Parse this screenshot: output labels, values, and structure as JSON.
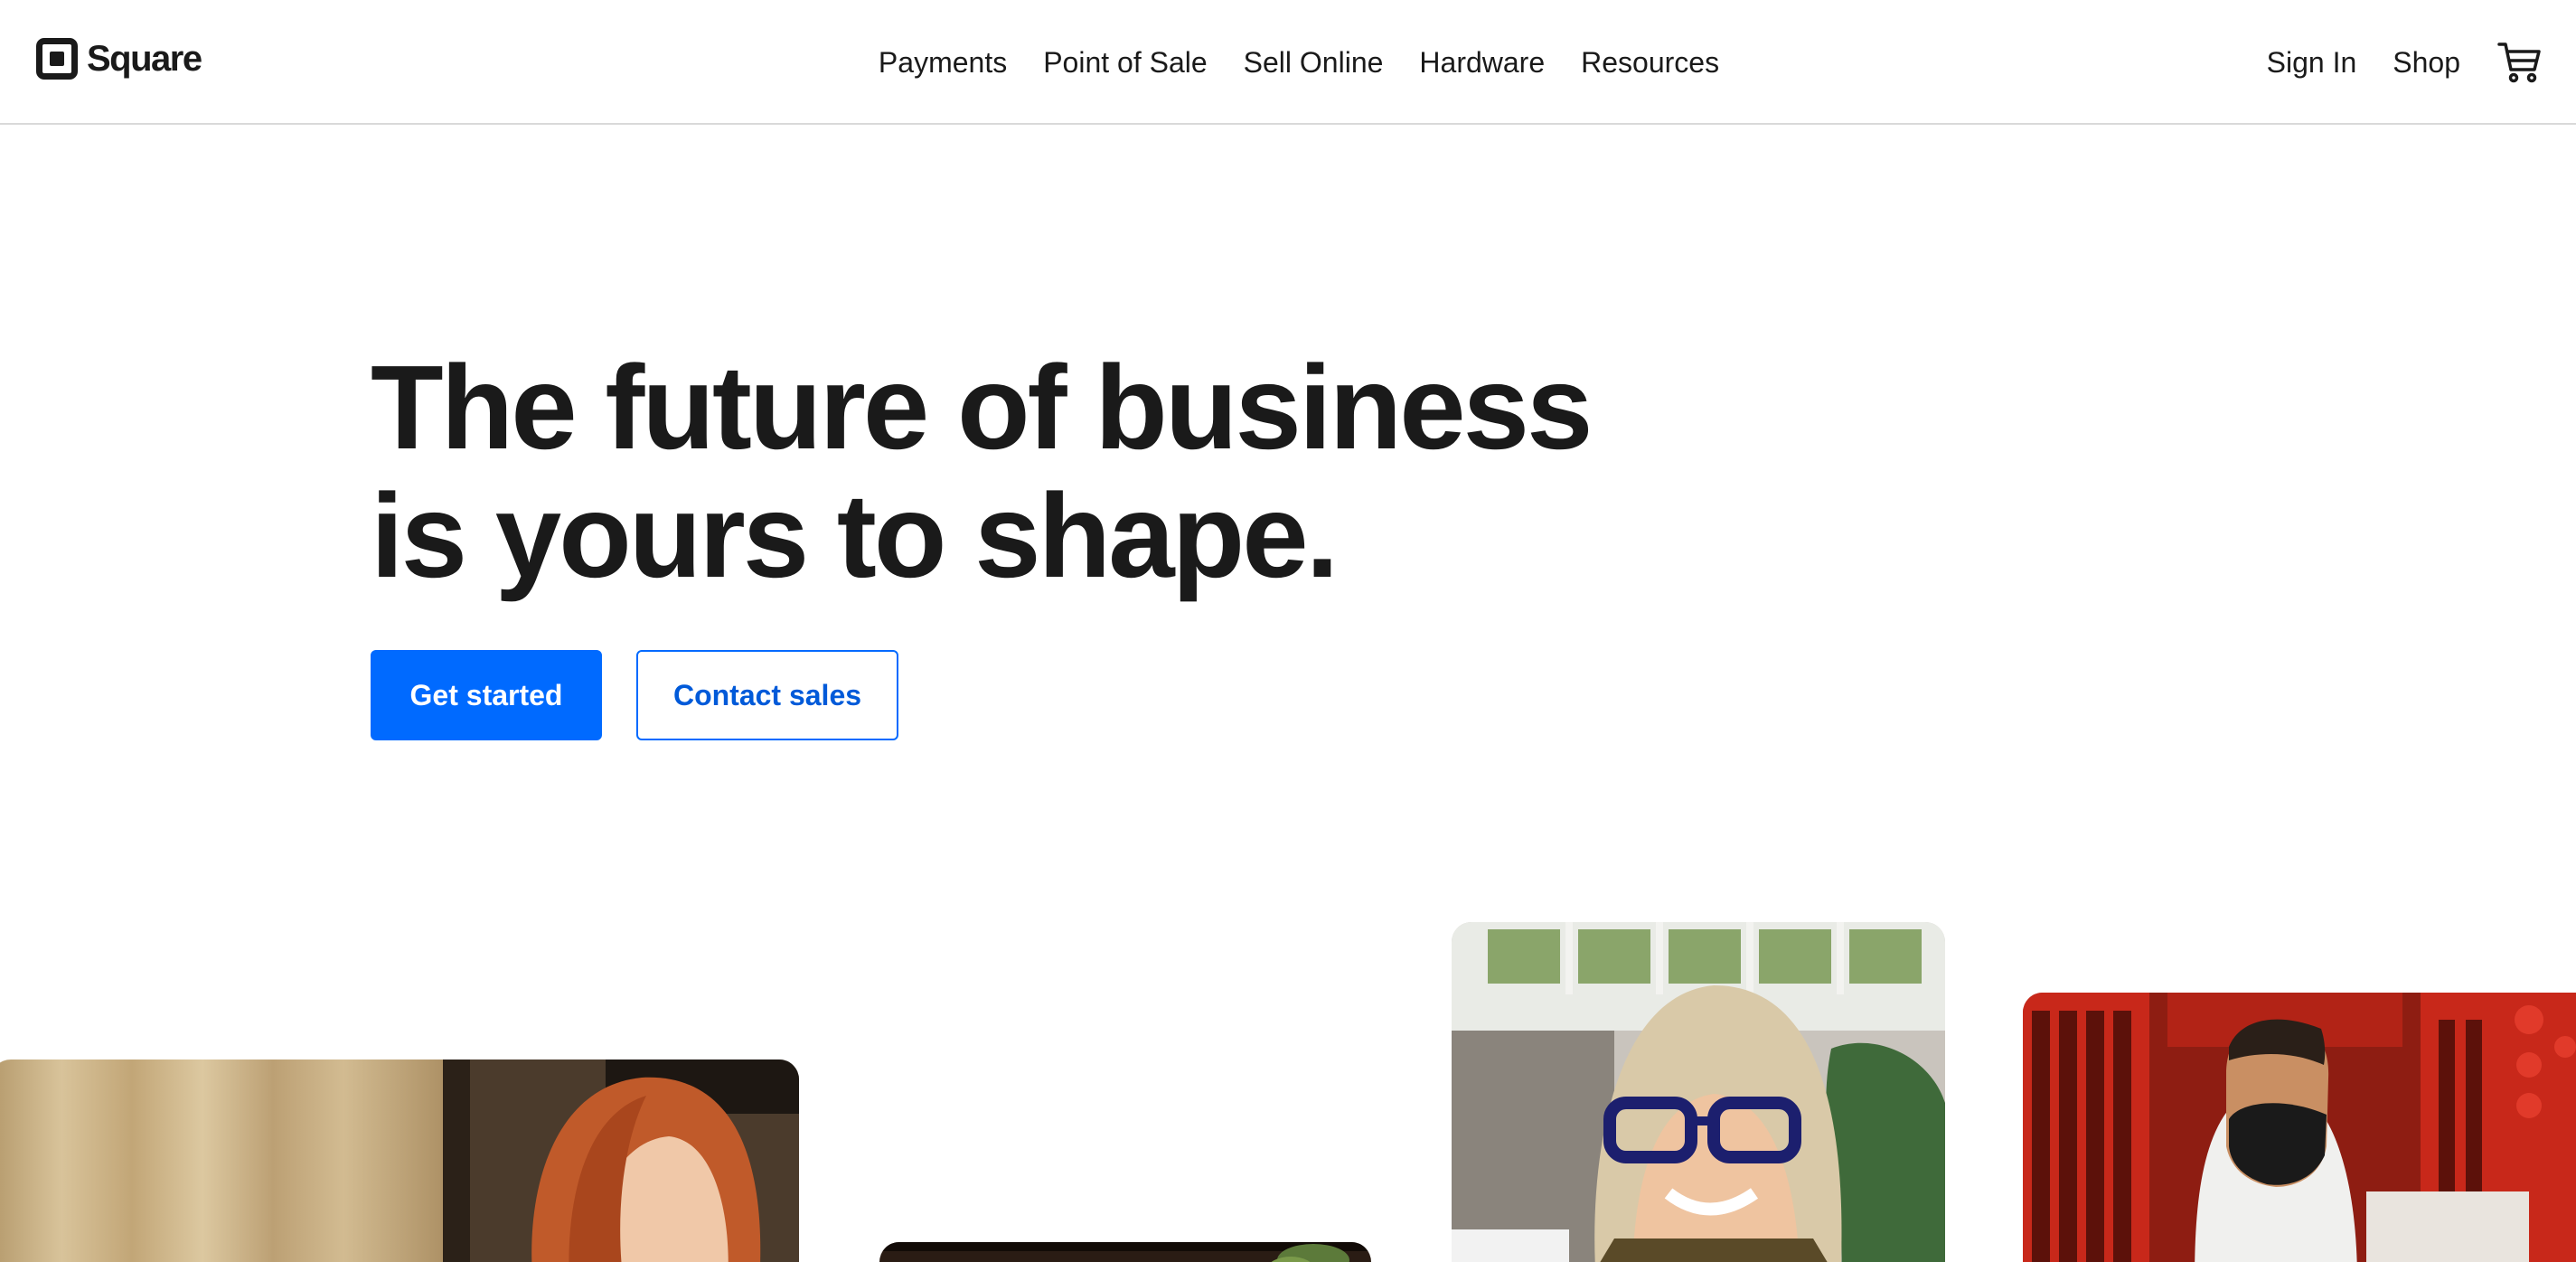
{
  "brand": {
    "name": "Square"
  },
  "nav": {
    "items": [
      {
        "label": "Payments"
      },
      {
        "label": "Point of Sale"
      },
      {
        "label": "Sell Online"
      },
      {
        "label": "Hardware"
      },
      {
        "label": "Resources"
      }
    ]
  },
  "account": {
    "sign_in": "Sign In",
    "shop": "Shop",
    "cart_icon": "shopping-cart-icon"
  },
  "hero": {
    "headline_line1": "The future of business",
    "headline_line2": "is yours to shape.",
    "primary_cta": "Get started",
    "secondary_cta": "Contact sales"
  },
  "colors": {
    "accent": "#006aff",
    "text": "#1a1a1a",
    "divider": "#d9d9d9"
  }
}
